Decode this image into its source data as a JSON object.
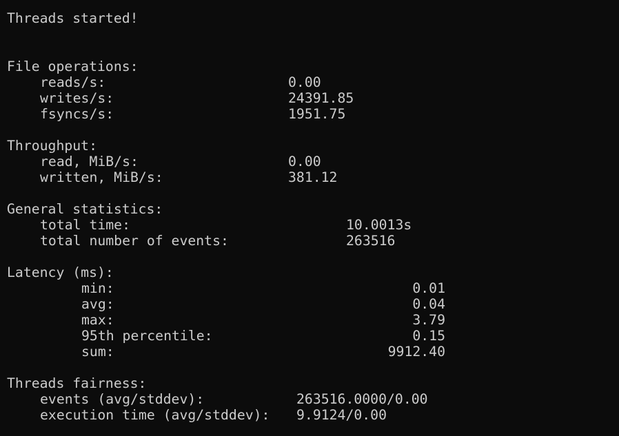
{
  "output": {
    "threads_started": "Threads started!",
    "file_operations": {
      "header": "File operations:",
      "reads_label": "reads/s:",
      "reads_value": "0.00",
      "writes_label": "writes/s:",
      "writes_value": "24391.85",
      "fsyncs_label": "fsyncs/s:",
      "fsyncs_value": "1951.75"
    },
    "throughput": {
      "header": "Throughput:",
      "read_label": "read, MiB/s:",
      "read_value": "0.00",
      "written_label": "written, MiB/s:",
      "written_value": "381.12"
    },
    "general_statistics": {
      "header": "General statistics:",
      "total_time_label": "total time:",
      "total_time_value": "10.0013s",
      "total_events_label": "total number of events:",
      "total_events_value": "263516"
    },
    "latency": {
      "header": "Latency (ms):",
      "min_label": "min:",
      "min_value": "0.01",
      "avg_label": "avg:",
      "avg_value": "0.04",
      "max_label": "max:",
      "max_value": "3.79",
      "p95_label": "95th percentile:",
      "p95_value": "0.15",
      "sum_label": "sum:",
      "sum_value": "9912.40"
    },
    "threads_fairness": {
      "header": "Threads fairness:",
      "events_label": "events (avg/stddev):",
      "events_value": "263516.0000/0.00",
      "exec_time_label": "execution time (avg/stddev):",
      "exec_time_value": "9.9124/0.00"
    }
  }
}
